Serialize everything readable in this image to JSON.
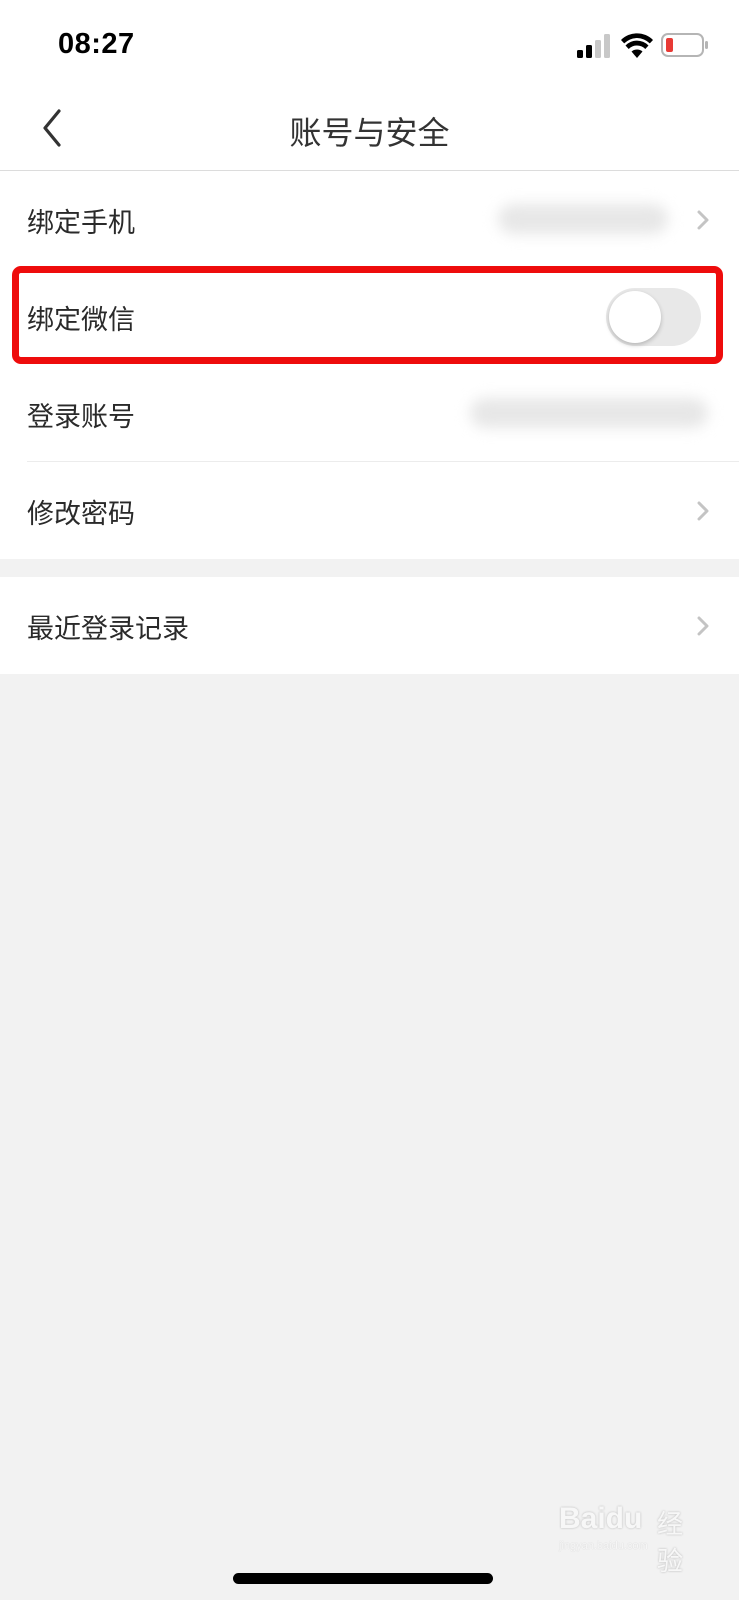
{
  "status_bar": {
    "time": "08:27",
    "icons": [
      "cellular-signal-icon",
      "wifi-icon",
      "battery-low-icon"
    ],
    "battery_color": "#e83a35"
  },
  "nav": {
    "title": "账号与安全",
    "back_icon": "chevron-left-icon"
  },
  "settings": {
    "group1": [
      {
        "label": "绑定手机",
        "value": "",
        "value_blurred": true,
        "control": "chevron"
      },
      {
        "label": "绑定微信",
        "control": "toggle",
        "toggle_on": false
      },
      {
        "label": "登录账号",
        "value": "",
        "value_blurred": true,
        "control": "none"
      },
      {
        "label": "修改密码",
        "control": "chevron"
      }
    ],
    "group2": [
      {
        "label": "最近登录记录",
        "control": "chevron"
      }
    ]
  },
  "highlight": {
    "target": "绑定微信",
    "color": "#ee0c0c"
  },
  "watermark": {
    "brand": "Baidu",
    "brand_cn": "经验",
    "url": "jingyan.baidu.com"
  }
}
